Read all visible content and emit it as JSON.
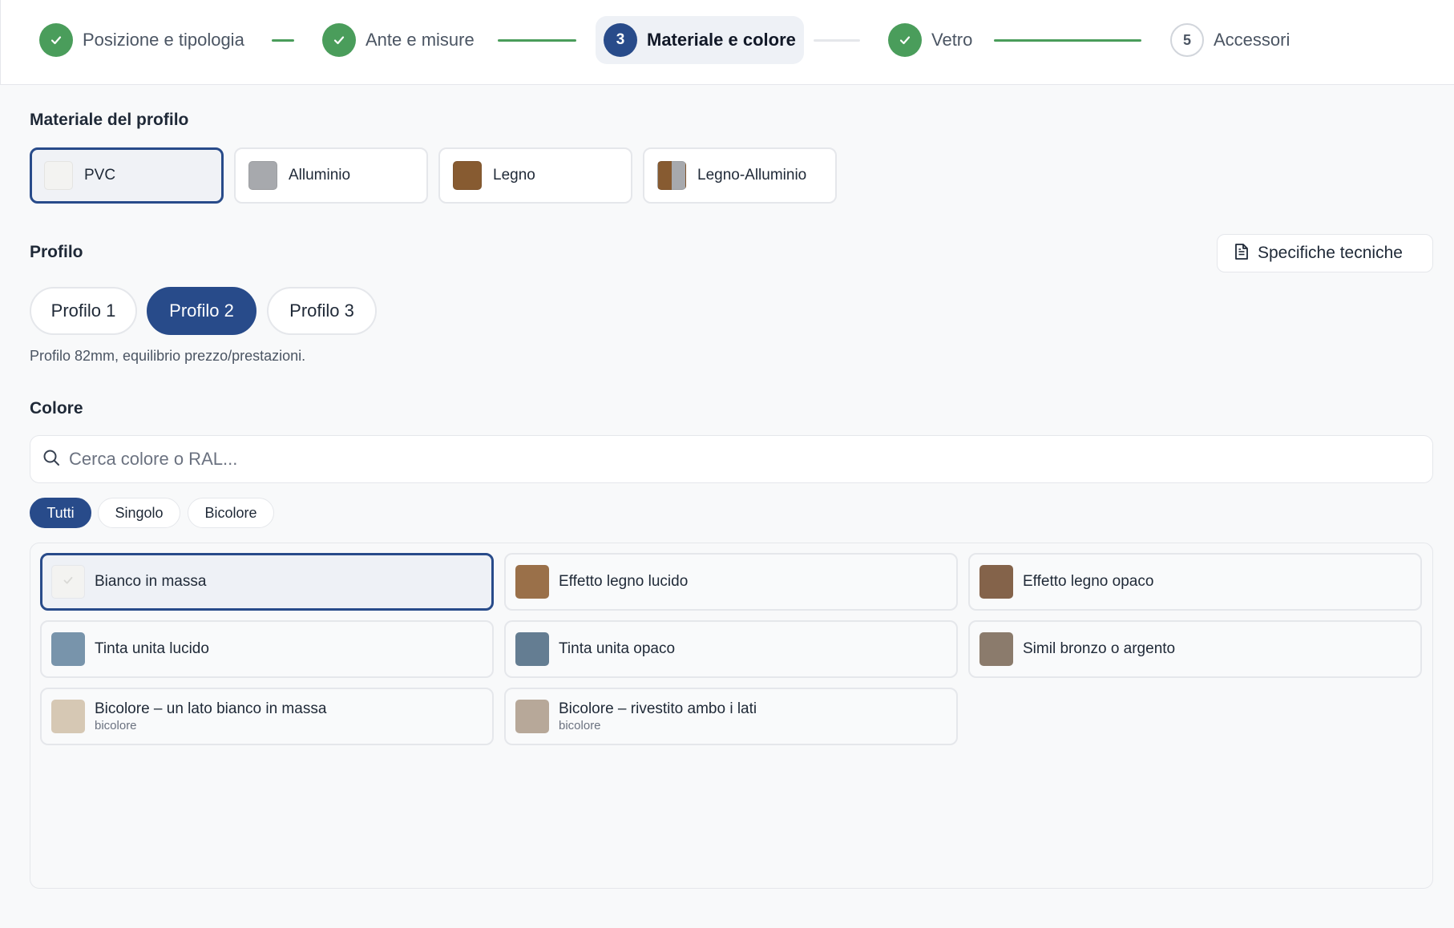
{
  "stepper": {
    "steps": [
      {
        "label": "Posizione e tipologia",
        "status": "done",
        "number": ""
      },
      {
        "label": "Ante e misure",
        "status": "done",
        "number": ""
      },
      {
        "label": "Materiale e colore",
        "status": "current",
        "number": "3"
      },
      {
        "label": "Vetro",
        "status": "done",
        "number": ""
      },
      {
        "label": "Accessori",
        "status": "pending",
        "number": "5"
      }
    ]
  },
  "material": {
    "title": "Materiale del profilo",
    "options": [
      {
        "label": "PVC",
        "swatch": "#f3f3f1",
        "selected": true
      },
      {
        "label": "Alluminio",
        "swatch": "#a7a9ad",
        "selected": false
      },
      {
        "label": "Legno",
        "swatch": "#875b31",
        "selected": false
      },
      {
        "label": "Legno-Alluminio",
        "swatch_left": "#875b31",
        "swatch_right": "#a7a9ad",
        "selected": false
      }
    ]
  },
  "profile": {
    "title": "Profilo",
    "spec_button": "Specifiche tecniche",
    "options": [
      {
        "label": "Profilo 1",
        "selected": false
      },
      {
        "label": "Profilo 2",
        "selected": true
      },
      {
        "label": "Profilo 3",
        "selected": false
      }
    ],
    "description": "Profilo 82mm, equilibrio prezzo/prestazioni."
  },
  "color": {
    "title": "Colore",
    "search_placeholder": "Cerca colore o RAL...",
    "filters": [
      {
        "label": "Tutti",
        "selected": true
      },
      {
        "label": "Singolo",
        "selected": false
      },
      {
        "label": "Bicolore",
        "selected": false
      }
    ],
    "options": [
      {
        "name": "Bianco in massa",
        "sub": "",
        "swatch": "#f3f3f1",
        "selected": true
      },
      {
        "name": "Effetto legno lucido",
        "sub": "",
        "swatch": "#9a7049",
        "selected": false
      },
      {
        "name": "Effetto legno opaco",
        "sub": "",
        "swatch": "#84634a",
        "selected": false
      },
      {
        "name": "Tinta unita lucido",
        "sub": "",
        "swatch": "#7894ab",
        "selected": false
      },
      {
        "name": "Tinta unita opaco",
        "sub": "",
        "swatch": "#647d92",
        "selected": false
      },
      {
        "name": "Simil bronzo o argento",
        "sub": "",
        "swatch": "#8b7b6c",
        "selected": false
      },
      {
        "name": "Bicolore – un lato bianco in massa",
        "sub": "bicolore",
        "swatch": "#d6c8b4",
        "selected": false
      },
      {
        "name": "Bicolore – rivestito ambo i lati",
        "sub": "bicolore",
        "swatch": "#b7a899",
        "selected": false
      }
    ]
  },
  "colors": {
    "accent": "#284b8a",
    "success": "#4a9d5b"
  }
}
